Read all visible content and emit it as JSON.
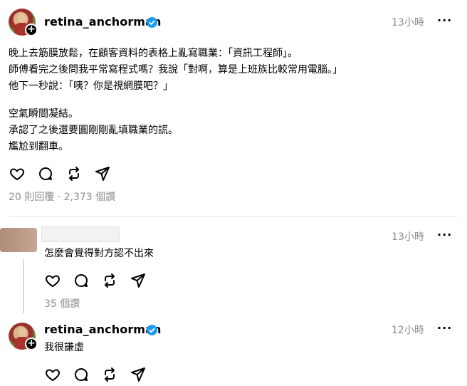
{
  "post": {
    "username": "retina_anchorman",
    "time": "13小時",
    "more": "···",
    "lines": [
      "晚上去筋膜放鬆，在顧客資料的表格上亂寫職業：「資訊工程師」。",
      "師傅看完之後問我平常寫程式嗎？我說「對啊，算是上班族比較常用電腦。」",
      "他下一秒說：「咦？你是視網膜吧？」",
      "空氣瞬間凝結。",
      "承認了之後還要圓剛剛亂填職業的謊。",
      "尷尬到翻車。"
    ],
    "stats": "20 則回覆 · 2,373 個讚",
    "icons": [
      "heart-icon",
      "comment-icon",
      "repost-icon",
      "share-icon"
    ]
  },
  "reply1": {
    "time": "13小時",
    "more": "···",
    "text": "怎麼會覺得對方認不出來",
    "likes": "35 個讚"
  },
  "reply2": {
    "username": "retina_anchorman",
    "time": "12小時",
    "more": "···",
    "text": "我很謙虛"
  },
  "colors": {
    "verified": "#1d9bf0",
    "muted": "#8e8e8e"
  }
}
